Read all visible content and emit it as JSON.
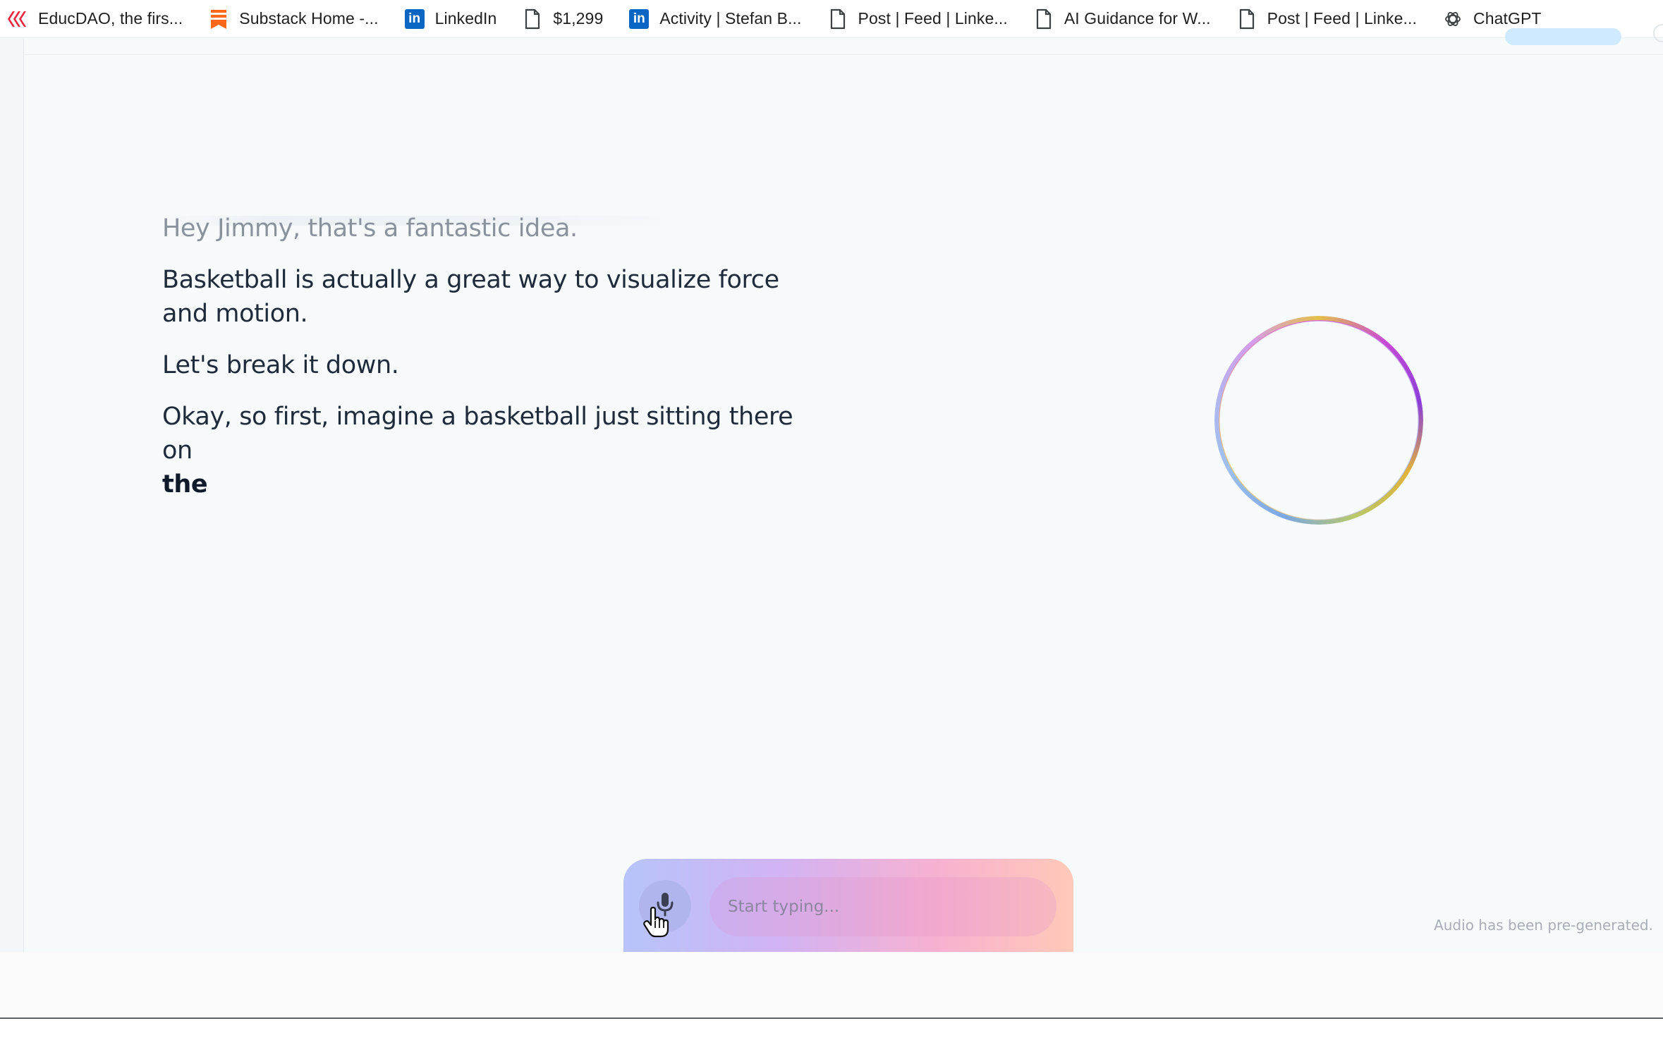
{
  "bookmarks": [
    {
      "label": "EducDAO, the firs...",
      "icon": "educdao-icon"
    },
    {
      "label": "Substack Home -...",
      "icon": "substack-icon"
    },
    {
      "label": "LinkedIn",
      "icon": "linkedin-icon"
    },
    {
      "label": "$1,299",
      "icon": "page-icon"
    },
    {
      "label": "Activity | Stefan B...",
      "icon": "linkedin-icon"
    },
    {
      "label": "Post | Feed | Linke...",
      "icon": "page-icon"
    },
    {
      "label": "AI Guidance for W...",
      "icon": "page-icon"
    },
    {
      "label": "Post | Feed | Linke...",
      "icon": "page-icon"
    },
    {
      "label": "ChatGPT",
      "icon": "chatgpt-icon"
    }
  ],
  "transcript": {
    "lines": [
      "Hey Jimmy, that's a fantastic idea.",
      "Basketball is actually a great way to visualize force and motion.",
      "Let's break it down.",
      "Okay, so first, imagine a basketball just sitting there on"
    ],
    "active_word": "the"
  },
  "composer": {
    "placeholder": "Start typing..."
  },
  "audio_note": "Audio has been pre-generated.",
  "colors": {
    "background": "#f7fafb",
    "text": "#1f2a3a",
    "dim_text": "#8a929c",
    "linkedin": "#0a66c2",
    "substack": "#ff6719",
    "educdao": "#e8253a"
  }
}
